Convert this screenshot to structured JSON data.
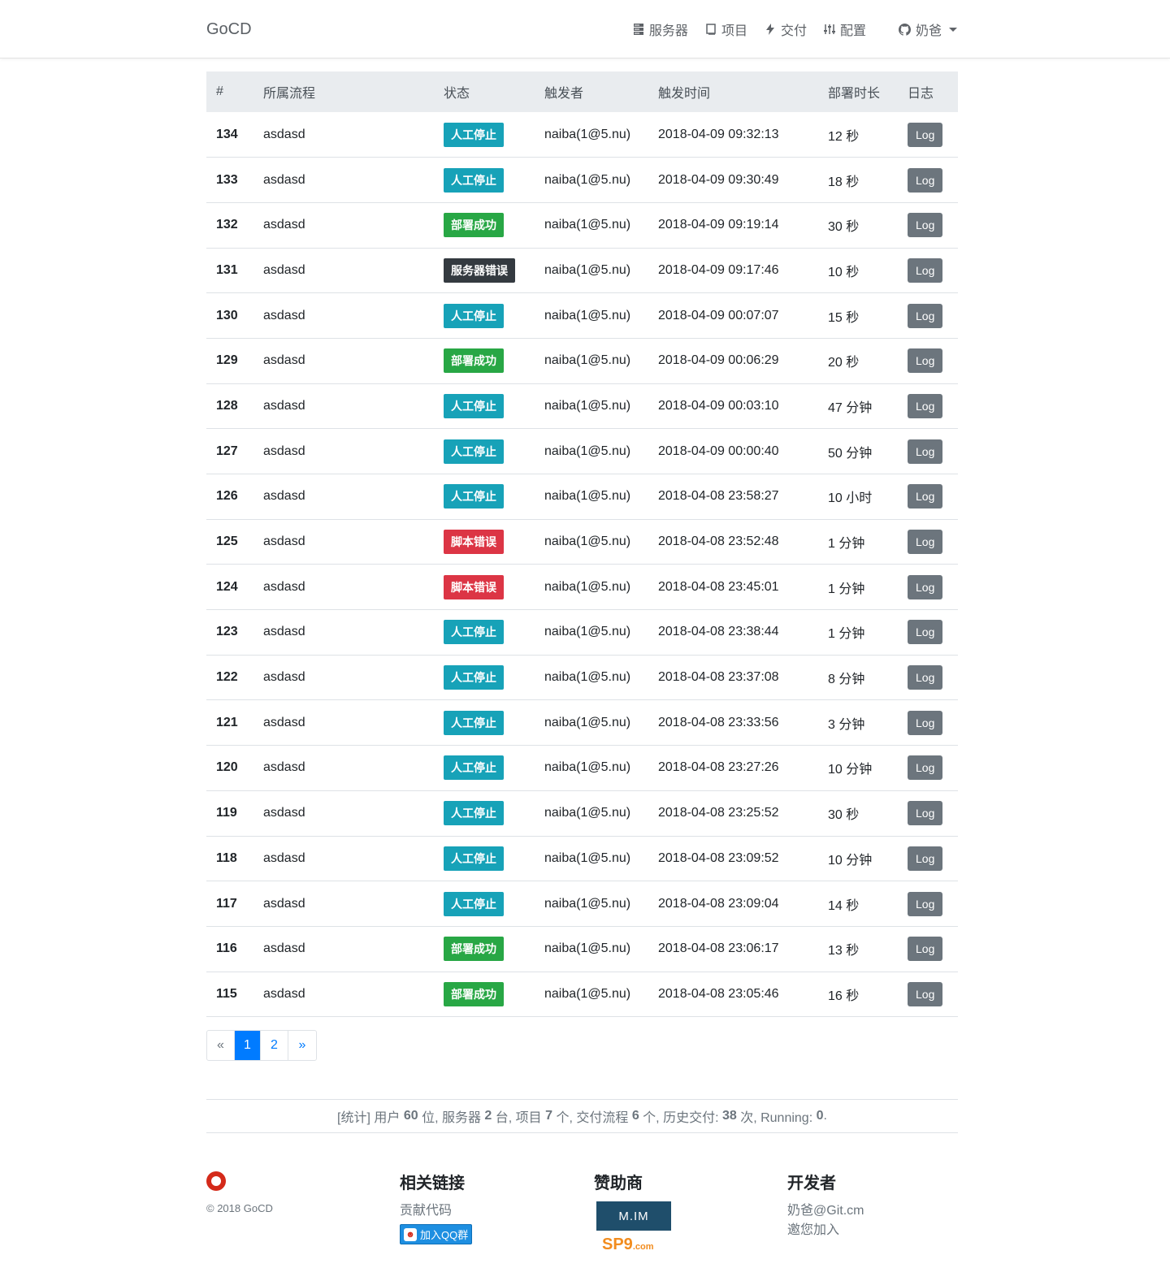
{
  "nav": {
    "brand": "GoCD",
    "items": [
      {
        "label": "服务器",
        "icon": "server-icon"
      },
      {
        "label": "项目",
        "icon": "book-icon"
      },
      {
        "label": "交付",
        "icon": "bolt-icon"
      },
      {
        "label": "配置",
        "icon": "sliders-icon"
      }
    ],
    "user": {
      "label": "奶爸",
      "icon": "github-icon"
    }
  },
  "table": {
    "headers": [
      "#",
      "所属流程",
      "状态",
      "触发者",
      "触发时间",
      "部署时长",
      "日志"
    ],
    "rows": [
      {
        "id": "134",
        "flow": "asdasd",
        "status": "人工停止",
        "status_color": "#17a2b8",
        "user": "naiba(1@5.nu)",
        "time": "2018-04-09 09:32:13",
        "duration": "12 秒",
        "log": "Log"
      },
      {
        "id": "133",
        "flow": "asdasd",
        "status": "人工停止",
        "status_color": "#17a2b8",
        "user": "naiba(1@5.nu)",
        "time": "2018-04-09 09:30:49",
        "duration": "18 秒",
        "log": "Log"
      },
      {
        "id": "132",
        "flow": "asdasd",
        "status": "部署成功",
        "status_color": "#28a745",
        "user": "naiba(1@5.nu)",
        "time": "2018-04-09 09:19:14",
        "duration": "30 秒",
        "log": "Log"
      },
      {
        "id": "131",
        "flow": "asdasd",
        "status": "服务器错误",
        "status_color": "#343a40",
        "user": "naiba(1@5.nu)",
        "time": "2018-04-09 09:17:46",
        "duration": "10 秒",
        "log": "Log"
      },
      {
        "id": "130",
        "flow": "asdasd",
        "status": "人工停止",
        "status_color": "#17a2b8",
        "user": "naiba(1@5.nu)",
        "time": "2018-04-09 00:07:07",
        "duration": "15 秒",
        "log": "Log"
      },
      {
        "id": "129",
        "flow": "asdasd",
        "status": "部署成功",
        "status_color": "#28a745",
        "user": "naiba(1@5.nu)",
        "time": "2018-04-09 00:06:29",
        "duration": "20 秒",
        "log": "Log"
      },
      {
        "id": "128",
        "flow": "asdasd",
        "status": "人工停止",
        "status_color": "#17a2b8",
        "user": "naiba(1@5.nu)",
        "time": "2018-04-09 00:03:10",
        "duration": "47 分钟",
        "log": "Log"
      },
      {
        "id": "127",
        "flow": "asdasd",
        "status": "人工停止",
        "status_color": "#17a2b8",
        "user": "naiba(1@5.nu)",
        "time": "2018-04-09 00:00:40",
        "duration": "50 分钟",
        "log": "Log"
      },
      {
        "id": "126",
        "flow": "asdasd",
        "status": "人工停止",
        "status_color": "#17a2b8",
        "user": "naiba(1@5.nu)",
        "time": "2018-04-08 23:58:27",
        "duration": "10 小时",
        "log": "Log"
      },
      {
        "id": "125",
        "flow": "asdasd",
        "status": "脚本错误",
        "status_color": "#dc3545",
        "user": "naiba(1@5.nu)",
        "time": "2018-04-08 23:52:48",
        "duration": "1 分钟",
        "log": "Log"
      },
      {
        "id": "124",
        "flow": "asdasd",
        "status": "脚本错误",
        "status_color": "#dc3545",
        "user": "naiba(1@5.nu)",
        "time": "2018-04-08 23:45:01",
        "duration": "1 分钟",
        "log": "Log"
      },
      {
        "id": "123",
        "flow": "asdasd",
        "status": "人工停止",
        "status_color": "#17a2b8",
        "user": "naiba(1@5.nu)",
        "time": "2018-04-08 23:38:44",
        "duration": "1 分钟",
        "log": "Log"
      },
      {
        "id": "122",
        "flow": "asdasd",
        "status": "人工停止",
        "status_color": "#17a2b8",
        "user": "naiba(1@5.nu)",
        "time": "2018-04-08 23:37:08",
        "duration": "8 分钟",
        "log": "Log"
      },
      {
        "id": "121",
        "flow": "asdasd",
        "status": "人工停止",
        "status_color": "#17a2b8",
        "user": "naiba(1@5.nu)",
        "time": "2018-04-08 23:33:56",
        "duration": "3 分钟",
        "log": "Log"
      },
      {
        "id": "120",
        "flow": "asdasd",
        "status": "人工停止",
        "status_color": "#17a2b8",
        "user": "naiba(1@5.nu)",
        "time": "2018-04-08 23:27:26",
        "duration": "10 分钟",
        "log": "Log"
      },
      {
        "id": "119",
        "flow": "asdasd",
        "status": "人工停止",
        "status_color": "#17a2b8",
        "user": "naiba(1@5.nu)",
        "time": "2018-04-08 23:25:52",
        "duration": "30 秒",
        "log": "Log"
      },
      {
        "id": "118",
        "flow": "asdasd",
        "status": "人工停止",
        "status_color": "#17a2b8",
        "user": "naiba(1@5.nu)",
        "time": "2018-04-08 23:09:52",
        "duration": "10 分钟",
        "log": "Log"
      },
      {
        "id": "117",
        "flow": "asdasd",
        "status": "人工停止",
        "status_color": "#17a2b8",
        "user": "naiba(1@5.nu)",
        "time": "2018-04-08 23:09:04",
        "duration": "14 秒",
        "log": "Log"
      },
      {
        "id": "116",
        "flow": "asdasd",
        "status": "部署成功",
        "status_color": "#28a745",
        "user": "naiba(1@5.nu)",
        "time": "2018-04-08 23:06:17",
        "duration": "13 秒",
        "log": "Log"
      },
      {
        "id": "115",
        "flow": "asdasd",
        "status": "部署成功",
        "status_color": "#28a745",
        "user": "naiba(1@5.nu)",
        "time": "2018-04-08 23:05:46",
        "duration": "16 秒",
        "log": "Log"
      }
    ]
  },
  "pagination": {
    "prev": "«",
    "pages": [
      "1",
      "2"
    ],
    "active": "1",
    "next": "»"
  },
  "stats": {
    "prefix": "[统计] 用户 ",
    "users": "60",
    "users_unit": " 位, 服务器 ",
    "servers": "2",
    "servers_unit": " 台, 项目 ",
    "projects": "7",
    "projects_unit": " 个, 交付流程 ",
    "pipelines": "6",
    "pipelines_unit": " 个, 历史交付: ",
    "history": "38",
    "history_unit": " 次, Running: ",
    "running": "0",
    "suffix": "."
  },
  "footer": {
    "copyright": "© 2018 GoCD",
    "links": {
      "title": "相关链接",
      "contribute": "贡献代码",
      "qq": "加入QQ群"
    },
    "sponsors": {
      "title": "赞助商",
      "sponsor1": "M.IM",
      "sponsor2": "SP9",
      "sponsor2_suffix": ".com"
    },
    "developers": {
      "title": "开发者",
      "dev": "奶爸@Git.cm",
      "invite": "邀您加入"
    }
  }
}
